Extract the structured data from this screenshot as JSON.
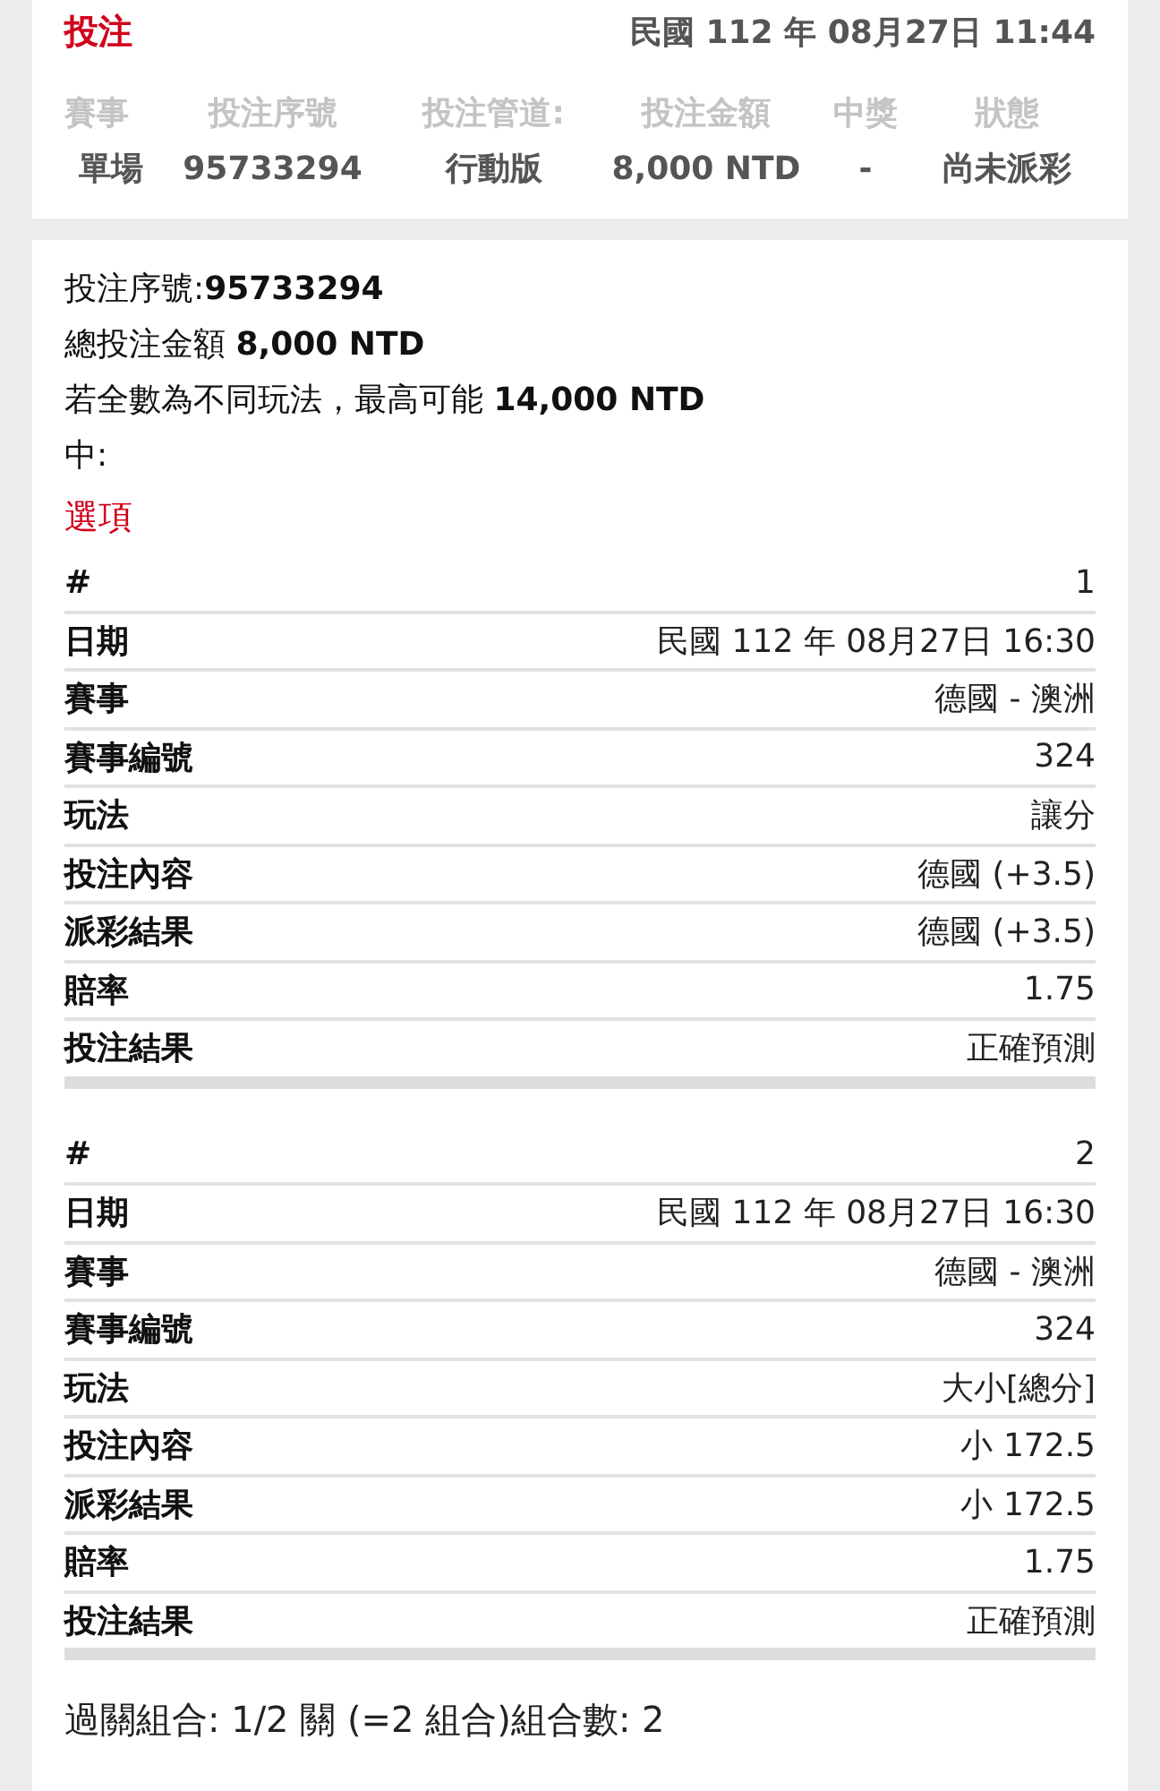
{
  "header": {
    "title": "投注",
    "datetime": "民國 112 年 08月27日 11:44",
    "columns": [
      "賽事",
      "投注序號",
      "投注管道:",
      "投注金額",
      "中獎",
      "狀態"
    ],
    "values": [
      "單場",
      "95733294",
      "行動版",
      "8,000 NTD",
      "-",
      "尚未派彩"
    ]
  },
  "summary": [
    "投注序號:**95733294**",
    "總投注金額 **8,000 NTD**",
    "若全數為不同玩法，最高可能 **14,000 NTD**",
    "中:"
  ],
  "options_title": "選項",
  "selections": [
    {
      "rows": [
        {
          "label": "#",
          "value": "1"
        },
        {
          "label": "日期",
          "value": "民國 112 年 08月27日 16:30"
        },
        {
          "label": "賽事",
          "value": "德國 - 澳洲"
        },
        {
          "label": "賽事編號",
          "value": "324"
        },
        {
          "label": "玩法",
          "value": "讓分"
        },
        {
          "label": "投注內容",
          "value": "德國 (+3.5)"
        },
        {
          "label": "派彩結果",
          "value": "德國 (+3.5)"
        },
        {
          "label": "賠率",
          "value": "1.75"
        },
        {
          "label": "投注結果",
          "value": "正確預測"
        }
      ]
    },
    {
      "rows": [
        {
          "label": "#",
          "value": "2"
        },
        {
          "label": "日期",
          "value": "民國 112 年 08月27日 16:30"
        },
        {
          "label": "賽事",
          "value": "德國 - 澳洲"
        },
        {
          "label": "賽事編號",
          "value": "324"
        },
        {
          "label": "玩法",
          "value": "大小[總分]"
        },
        {
          "label": "投注內容",
          "value": "小 172.5"
        },
        {
          "label": "派彩結果",
          "value": "小 172.5"
        },
        {
          "label": "賠率",
          "value": "1.75"
        },
        {
          "label": "投注結果",
          "value": "正確預測"
        }
      ]
    }
  ],
  "combo": "過關組合: 1/2 關 (=2 組合)組合數: 2"
}
